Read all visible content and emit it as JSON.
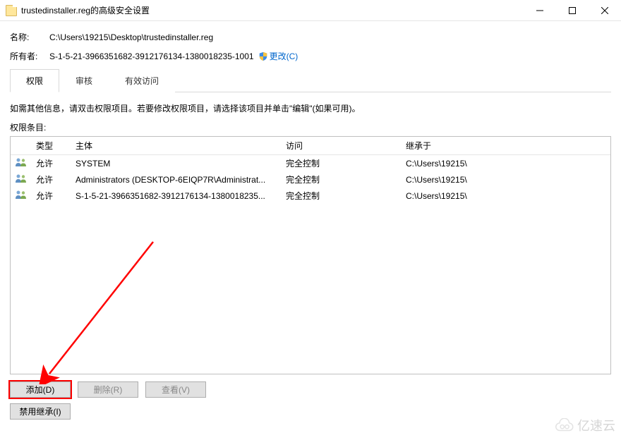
{
  "window": {
    "title": "trustedinstaller.reg的高级安全设置"
  },
  "labels": {
    "name": "名称:",
    "owner": "所有者:"
  },
  "values": {
    "name": "C:\\Users\\19215\\Desktop\\trustedinstaller.reg",
    "owner": "S-1-5-21-3966351682-3912176134-1380018235-1001",
    "change": "更改(C)"
  },
  "tabs": {
    "permissions": "权限",
    "audit": "审核",
    "effective": "有效访问"
  },
  "instruction": "如需其他信息，请双击权限项目。若要修改权限项目，请选择该项目并单击\"编辑\"(如果可用)。",
  "entries_label": "权限条目:",
  "columns": {
    "type": "类型",
    "principal": "主体",
    "access": "访问",
    "inherited": "继承于"
  },
  "rows": [
    {
      "type": "允许",
      "principal": "SYSTEM",
      "access": "完全控制",
      "inherited": "C:\\Users\\19215\\"
    },
    {
      "type": "允许",
      "principal": "Administrators (DESKTOP-6EIQP7R\\Administrat...",
      "access": "完全控制",
      "inherited": "C:\\Users\\19215\\"
    },
    {
      "type": "允许",
      "principal": "S-1-5-21-3966351682-3912176134-1380018235...",
      "access": "完全控制",
      "inherited": "C:\\Users\\19215\\"
    }
  ],
  "buttons": {
    "add": "添加(D)",
    "remove": "删除(R)",
    "view": "查看(V)",
    "disable_inherit": "禁用继承(I)"
  },
  "watermark": "亿速云"
}
